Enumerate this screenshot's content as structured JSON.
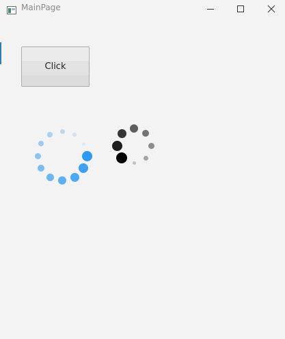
{
  "window": {
    "title": "MainPage",
    "icon": "app-window-icon",
    "caption_buttons": [
      "minimize-icon",
      "maximize-icon",
      "close-icon"
    ]
  },
  "main": {
    "button_label": "Click"
  },
  "colors": {
    "background": "#f3f3f3",
    "title_text": "#8a8a8a",
    "blue_spinner": "#2196f3",
    "dark_spinner": "#000000",
    "window_edge_accent": "#2d7fb6"
  },
  "spinners": [
    {
      "name": "blue-loading-spinner",
      "color": "#2196f3",
      "dot_count": 12
    },
    {
      "name": "dark-loading-spinner",
      "color": "#000000",
      "dot_count": 8
    }
  ]
}
